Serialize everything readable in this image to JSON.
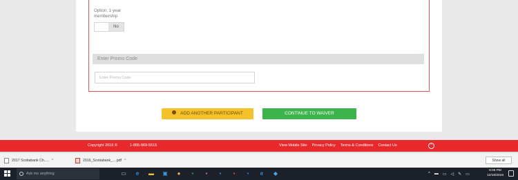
{
  "form": {
    "option_label": "Option: 1-year membership",
    "toggle_value": "No",
    "promo_header": "Enter Promo Code",
    "promo_placeholder": "Enter Promo Code"
  },
  "actions": {
    "add_participant": "ADD ANOTHER PARTICIPANT",
    "continue": "CONTINUE TO WAIVER"
  },
  "footer": {
    "copyright": "Copyright 2016 ©",
    "phone": "1-855-969-5515",
    "links": [
      "View Mobile Site",
      "Privacy Policy",
      "Terms & Conditions",
      "Contact Us"
    ]
  },
  "downloads": {
    "items": [
      {
        "name": "2017 Scotiabank Ch.....",
        "type": "doc"
      },
      {
        "name": "2016_Scotiabank_....pdf",
        "type": "pdf"
      }
    ],
    "show_all": "Show all"
  },
  "taskbar": {
    "search_placeholder": "Ask me anything",
    "clock_time": "6:05 PM",
    "clock_date": "12/16/2016",
    "apps": [
      "task-view-icon",
      "edge-icon",
      "file-explorer-icon",
      "store-icon",
      "chrome-icon",
      "excel-icon",
      "powerpoint-icon",
      "outlook-icon",
      "onenote-icon",
      "word-icon",
      "edge-icon",
      "app-icon"
    ]
  },
  "colors": {
    "accent_red": "#e8292b",
    "button_yellow": "#f5c12a",
    "button_green": "#3cb44b",
    "taskbar": "#1c2129"
  }
}
